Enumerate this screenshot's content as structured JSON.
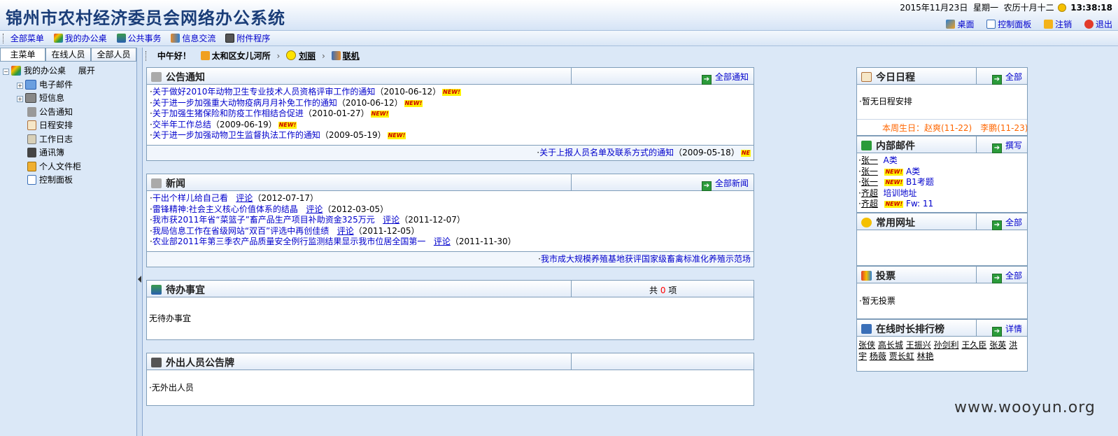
{
  "header": {
    "title": "锦州市农村经济委员会网络办公系统",
    "date": "2015年11月23日",
    "weekday": "星期一",
    "lunar": "农历十月十二",
    "time": "13:38:18",
    "links": {
      "desktop": "桌面",
      "control_panel": "控制面板",
      "logout": "注销",
      "exit": "退出"
    }
  },
  "menubar": {
    "items": [
      "全部菜单",
      "我的办公桌",
      "公共事务",
      "信息交流",
      "附件程序"
    ]
  },
  "left": {
    "tabs": [
      "主菜单",
      "在线人员",
      "全部人员"
    ],
    "root": {
      "label": "我的办公桌",
      "expand": "展开"
    },
    "items": [
      "电子邮件",
      "短信息",
      "公告通知",
      "日程安排",
      "工作日志",
      "通讯簿",
      "个人文件柜",
      "控制面板"
    ]
  },
  "crumb": {
    "greeting": "中午好！",
    "dept": "太和区女儿河所",
    "user": "刘丽",
    "status": "联机"
  },
  "notices": {
    "title": "公告通知",
    "more": "全部通知",
    "new_badge": "NEW!",
    "items": [
      {
        "text": "关于做好2010年动物卫生专业技术人员资格评审工作的通知",
        "date": "（2010-06-12）"
      },
      {
        "text": "关于进一步加强重大动物疫病月月补免工作的通知",
        "date": "（2010-06-12）"
      },
      {
        "text": "关于加强生猪保险和防疫工作相结合促进",
        "date": "（2010-01-27）"
      },
      {
        "text": "交半年工作总结",
        "date": "（2009-06-19）"
      },
      {
        "text": "关于进一步加强动物卫生监督执法工作的通知",
        "date": "（2009-05-19）"
      }
    ],
    "scroll": {
      "text": "关于上报人员名单及联系方式的通知",
      "date": "（2009-05-18）",
      "badge": "NE"
    }
  },
  "news": {
    "title": "新闻",
    "more": "全部新闻",
    "comment": "评论",
    "items": [
      {
        "text": "干出个样儿给自己看",
        "date": "（2012-07-17）"
      },
      {
        "text": "雷锋精神:社会主义核心价值体系的结晶",
        "date": "（2012-03-05）"
      },
      {
        "text": "我市获2011年省“菜篮子”畜产品生产项目补助资金325万元",
        "date": "（2011-12-07）"
      },
      {
        "text": "我局信息工作在省级网站“双百”评选中再创佳绩",
        "date": "（2011-12-05）"
      },
      {
        "text": "农业部2011年第三季农产品质量安全例行监测结果显示我市位居全国第一",
        "date": "（2011-11-30）"
      }
    ],
    "scroll": "我市成大规模养殖基地获评国家级畜禽标准化养殖示范场"
  },
  "todo": {
    "title": "待办事宜",
    "count_prefix": "共",
    "count": "0",
    "count_suffix": "项",
    "empty": "无待办事宜"
  },
  "outgoing": {
    "title": "外出人员公告牌",
    "empty": "·无外出人员"
  },
  "schedule": {
    "title": "今日日程",
    "more": "全部",
    "empty": "·暂无日程安排",
    "birthday": "本周生日：赵爽(11-22)　李鹏(11-23)"
  },
  "mail": {
    "title": "内部邮件",
    "more": "撰写",
    "items": [
      {
        "from": "张一",
        "new": false,
        "subject": "A类"
      },
      {
        "from": "张一",
        "new": true,
        "subject": "A类"
      },
      {
        "from": "张一",
        "new": true,
        "subject": "B1考题"
      },
      {
        "from": "齐超",
        "new": false,
        "subject": "培训地址"
      },
      {
        "from": "齐超",
        "new": true,
        "subject": "Fw: 11"
      }
    ]
  },
  "urls": {
    "title": "常用网址",
    "more": "全部"
  },
  "vote": {
    "title": "投票",
    "more": "全部",
    "empty": "·暂无投票"
  },
  "online_rank": {
    "title": "在线时长排行榜",
    "more": "详情",
    "names": [
      "张侠",
      "高长城",
      "王振兴",
      "孙剑利",
      "王久臣",
      "张英",
      "洪宇",
      "杨薇",
      "贾长虹",
      "林艳"
    ]
  },
  "watermark": "www.wooyun.org",
  "colors": {
    "link": "#0000cc",
    "header_title": "#1a3d78",
    "birthday": "#ff6600",
    "count": "#ff0000",
    "new_badge_bg": "#fff200",
    "new_badge_fg": "#cc0000"
  }
}
